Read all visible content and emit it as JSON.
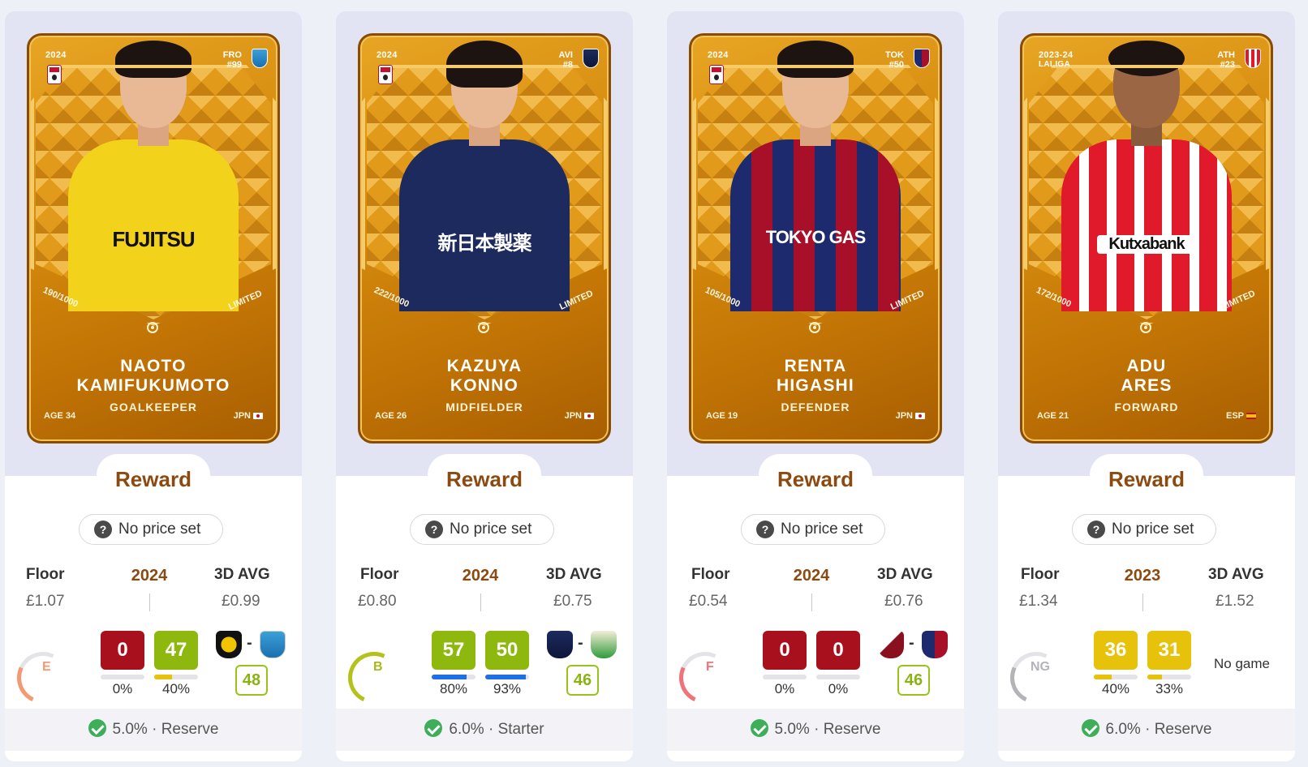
{
  "reward_label": "Reward",
  "price_label": "No price set",
  "floor_label": "Floor",
  "avg_label": "3D AVG",
  "colors": {
    "reward_text": "#8a4a10",
    "score_red": "#a8101e",
    "score_green": "#8fb80f",
    "score_yellow": "#e6c20a",
    "bar_blue": "#1f6fe5",
    "bar_yellow": "#e6c20a",
    "check_green": "#3fae5a"
  },
  "cards": [
    {
      "season": "2024",
      "season_sub": "",
      "club_code": "FRO",
      "jersey": "#99",
      "first_name": "NAOTO",
      "last_name": "KAMIFUKUMOTO",
      "position": "GOALKEEPER",
      "age": "AGE 34",
      "nationality": "JPN",
      "serial": "190/1000",
      "rarity": "LIMITED",
      "sponsor": "FUJITSU",
      "year": "2024",
      "floor": "£1.07",
      "avg": "£0.99",
      "grade": "E",
      "scores": [
        {
          "value": "0",
          "pct": "0%",
          "fill": 0,
          "color": "red"
        },
        {
          "value": "47",
          "pct": "40%",
          "fill": 0.4,
          "color": "green"
        }
      ],
      "fixture": "48",
      "no_game": "",
      "footer_pct": "5.0%",
      "footer_role": "· Reserve"
    },
    {
      "season": "2024",
      "season_sub": "",
      "club_code": "AVI",
      "jersey": "#8",
      "first_name": "KAZUYA",
      "last_name": "KONNO",
      "position": "MIDFIELDER",
      "age": "AGE 26",
      "nationality": "JPN",
      "serial": "222/1000",
      "rarity": "LIMITED",
      "sponsor": "新日本製薬",
      "year": "2024",
      "floor": "£0.80",
      "avg": "£0.75",
      "grade": "B",
      "scores": [
        {
          "value": "57",
          "pct": "80%",
          "fill": 0.8,
          "color": "green"
        },
        {
          "value": "50",
          "pct": "93%",
          "fill": 0.93,
          "color": "green"
        }
      ],
      "fixture": "46",
      "no_game": "",
      "footer_pct": "6.0%",
      "footer_role": "· Starter"
    },
    {
      "season": "2024",
      "season_sub": "",
      "club_code": "TOK",
      "jersey": "#50",
      "first_name": "RENTA",
      "last_name": "HIGASHI",
      "position": "DEFENDER",
      "age": "AGE 19",
      "nationality": "JPN",
      "serial": "105/1000",
      "rarity": "LIMITED",
      "sponsor": "TOKYO GAS",
      "year": "2024",
      "floor": "£0.54",
      "avg": "£0.76",
      "grade": "F",
      "scores": [
        {
          "value": "0",
          "pct": "0%",
          "fill": 0,
          "color": "red"
        },
        {
          "value": "0",
          "pct": "0%",
          "fill": 0,
          "color": "red"
        }
      ],
      "fixture": "46",
      "no_game": "",
      "footer_pct": "5.0%",
      "footer_role": "· Reserve"
    },
    {
      "season": "2023-24",
      "season_sub": "LALIGA",
      "club_code": "ATH",
      "jersey": "#23",
      "first_name": "ADU",
      "last_name": "ARES",
      "position": "FORWARD",
      "age": "AGE 21",
      "nationality": "ESP",
      "serial": "172/1000",
      "rarity": "LIMITED",
      "sponsor": "Kutxabank",
      "year": "2023",
      "floor": "£1.34",
      "avg": "£1.52",
      "grade": "NG",
      "scores": [
        {
          "value": "36",
          "pct": "40%",
          "fill": 0.4,
          "color": "yellow"
        },
        {
          "value": "31",
          "pct": "33%",
          "fill": 0.33,
          "color": "yellow"
        }
      ],
      "fixture": "",
      "no_game": "No game",
      "footer_pct": "6.0%",
      "footer_role": "· Reserve"
    }
  ]
}
